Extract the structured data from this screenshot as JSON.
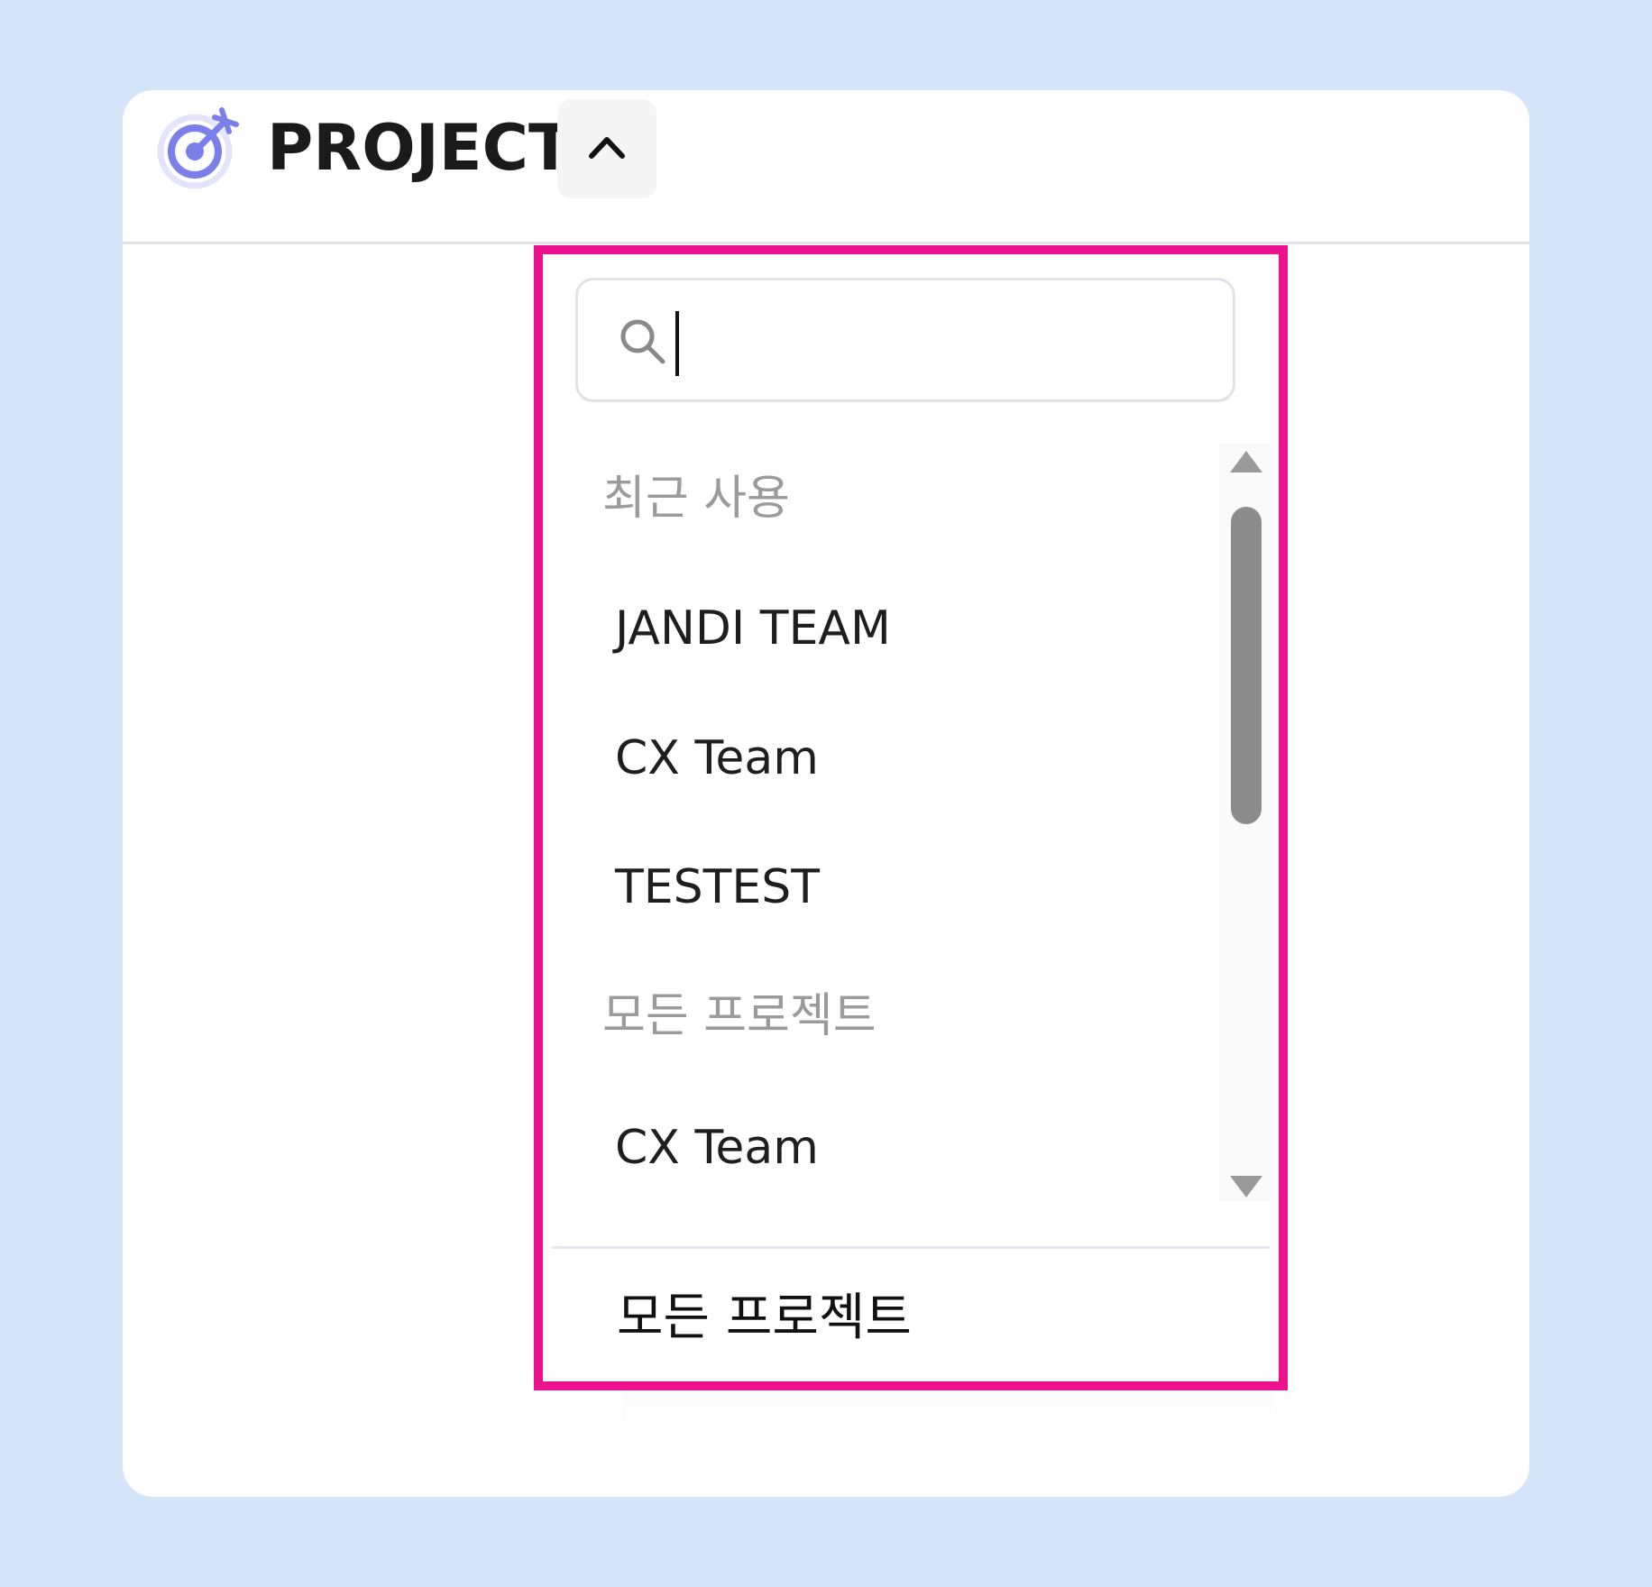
{
  "header": {
    "title": "PROJECT",
    "icon": "target-dart-icon",
    "toggle_icon": "chevron-up-icon"
  },
  "dropdown": {
    "search": {
      "value": "",
      "icon": "search-icon"
    },
    "sections": [
      {
        "header": "최근 사용",
        "items": [
          "JANDI TEAM",
          "CX Team",
          "TESTEST"
        ]
      },
      {
        "header": "모든 프로젝트",
        "items": [
          "CX Team"
        ]
      }
    ],
    "footer_link": "모든 프로젝트",
    "highlight_color": "#ec118f"
  },
  "colors": {
    "background": "#d4e4f9",
    "icon_accent": "#7b7fe8"
  }
}
